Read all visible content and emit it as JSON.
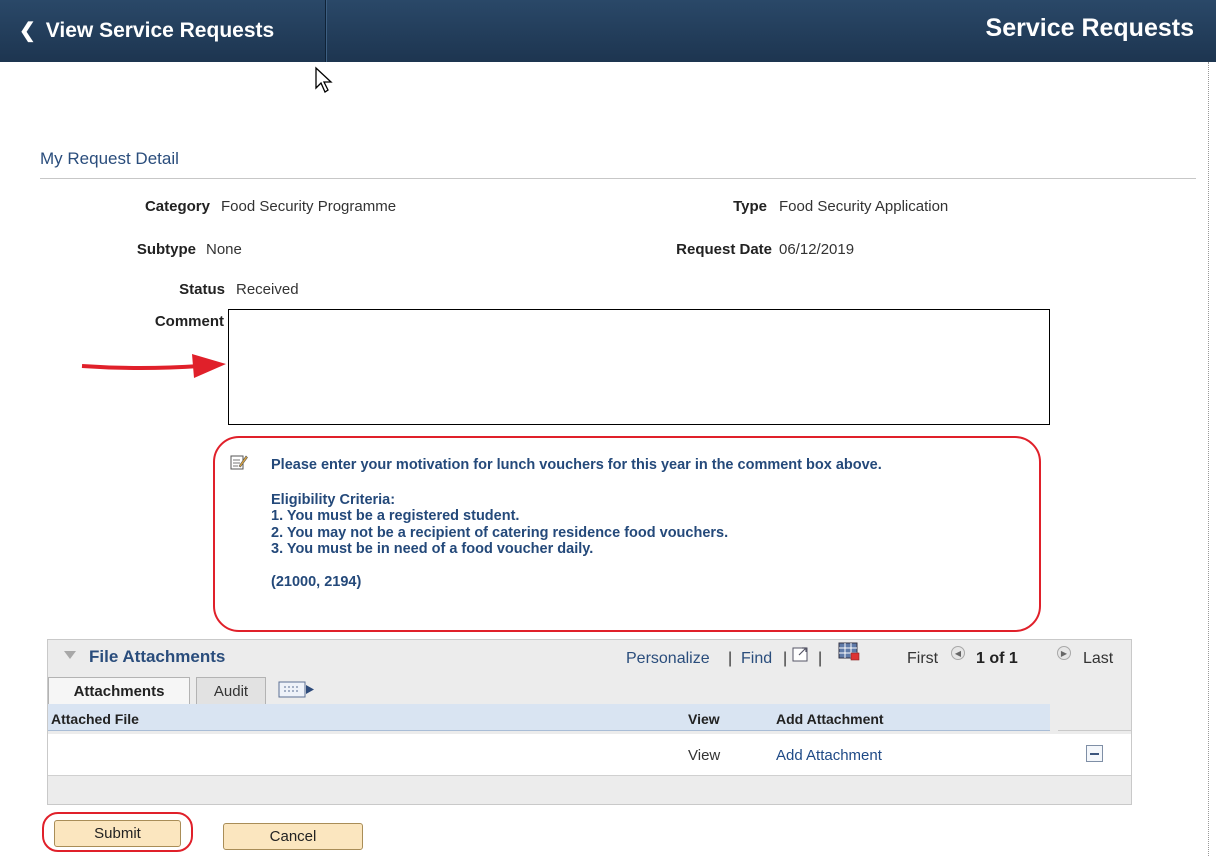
{
  "header": {
    "back_label": "View Service Requests",
    "page_title": "Service Requests"
  },
  "section": {
    "title": "My Request Detail"
  },
  "fields": {
    "category_label": "Category",
    "category_value": "Food Security Programme",
    "type_label": "Type",
    "type_value": "Food Security Application",
    "subtype_label": "Subtype",
    "subtype_value": "None",
    "request_date_label": "Request Date",
    "request_date_value": "06/12/2019",
    "status_label": "Status",
    "status_value": "Received",
    "comment_label": "Comment",
    "comment_value": ""
  },
  "info": {
    "line1": "Please enter your motivation for lunch vouchers for this year in the comment box above.",
    "criteria_title": "Eligibility Criteria:",
    "criteria": [
      "1. You must be a registered student.",
      "2. You may not be a recipient of catering residence food vouchers.",
      "3. You must be in need of a food voucher daily."
    ],
    "code": "(21000, 2194)"
  },
  "attachments": {
    "title": "File Attachments",
    "personalize": "Personalize",
    "find": "Find",
    "first": "First",
    "count": "1 of 1",
    "last": "Last",
    "tabs": [
      "Attachments",
      "Audit"
    ],
    "columns": [
      "Attached File",
      "View",
      "Add Attachment"
    ],
    "rows": [
      {
        "attached_file": "",
        "view": "View",
        "add_attachment": "Add Attachment"
      }
    ]
  },
  "buttons": {
    "submit": "Submit",
    "cancel": "Cancel"
  },
  "colors": {
    "header_bg": "#1d3550",
    "accent_red": "#e0202a",
    "button_bg": "#fbe6bf",
    "link_blue": "#2a4d7c"
  }
}
